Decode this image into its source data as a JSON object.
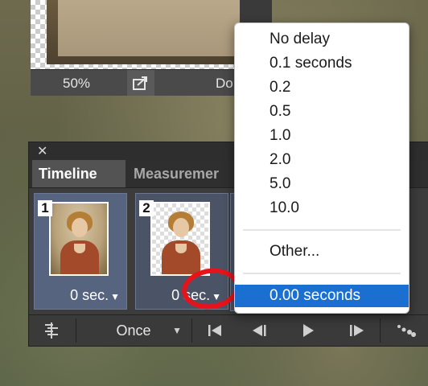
{
  "document": {
    "zoom": "50%",
    "status_text": "Do"
  },
  "panel": {
    "tabs": [
      "Timeline",
      "Measuremer"
    ],
    "frames": [
      {
        "number": "1",
        "delay": "0 sec."
      },
      {
        "number": "2",
        "delay": "0 sec."
      }
    ],
    "loop_option": "Once"
  },
  "delay_menu": {
    "items": [
      "No delay",
      "0.1 seconds",
      "0.2",
      "0.5",
      "1.0",
      "2.0",
      "5.0",
      "10.0"
    ],
    "other": "Other...",
    "selected": "0.00 seconds"
  },
  "colors": {
    "selection": "#1a6fd0",
    "annotation_circle": "#e8121b"
  }
}
